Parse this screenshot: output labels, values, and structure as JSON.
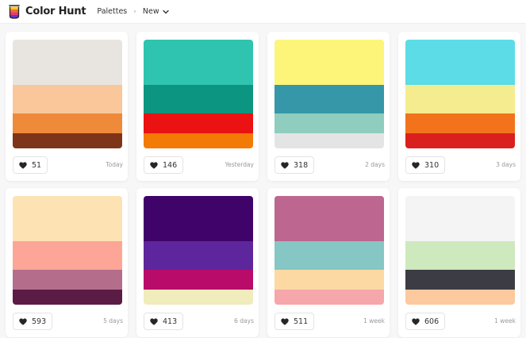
{
  "header": {
    "brand": "Color Hunt",
    "nav_palettes": "Palettes",
    "nav_new": "New"
  },
  "palettes": [
    {
      "colors": [
        "#e8e4df",
        "#f9c79a",
        "#ef8a3a",
        "#7d3418"
      ],
      "likes": "51",
      "date": "Today"
    },
    {
      "colors": [
        "#2ec4b0",
        "#0c9580",
        "#ea1212",
        "#f27a05"
      ],
      "likes": "146",
      "date": "Yesterday"
    },
    {
      "colors": [
        "#fdf57a",
        "#3597a8",
        "#8fcdbe",
        "#e4e4e4"
      ],
      "likes": "318",
      "date": "2 days"
    },
    {
      "colors": [
        "#5bdce6",
        "#f5ec8f",
        "#f2731c",
        "#da1f1f"
      ],
      "likes": "310",
      "date": "3 days"
    },
    {
      "colors": [
        "#fde2b4",
        "#fda597",
        "#b46e8c",
        "#5a1c44"
      ],
      "likes": "593",
      "date": "5 days"
    },
    {
      "colors": [
        "#3f036a",
        "#5e269c",
        "#b80b6a",
        "#f0ecbc"
      ],
      "likes": "413",
      "date": "6 days"
    },
    {
      "colors": [
        "#bc6690",
        "#86c6c4",
        "#fcd9a3",
        "#f6a7ab"
      ],
      "likes": "511",
      "date": "1 week"
    },
    {
      "colors": [
        "#f4f4f4",
        "#cde9bd",
        "#3c3c44",
        "#fdc99e"
      ],
      "likes": "606",
      "date": "1 week"
    }
  ]
}
